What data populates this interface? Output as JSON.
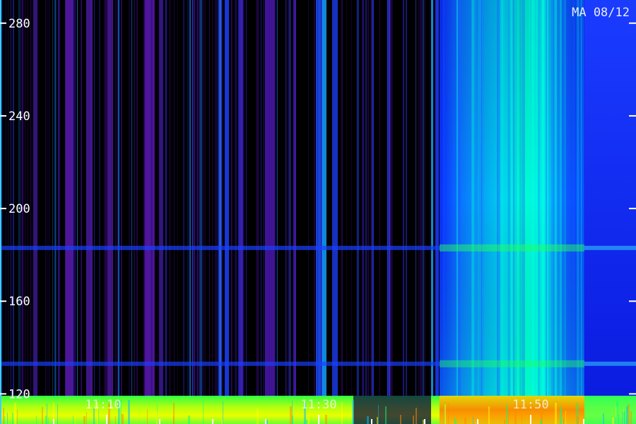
{
  "chart_data": {
    "type": "heatmap",
    "title": "",
    "panel_label": "MA 08/12",
    "xlabel": "",
    "ylabel": "",
    "x_tick_labels": [
      "11:10",
      "11:30",
      "11:50"
    ],
    "y_ticks": [
      120,
      160,
      200,
      240,
      280
    ],
    "ylim": [
      107,
      290
    ],
    "colormap": [
      "#000000",
      "#5a1aa8",
      "#1a2aff",
      "#00ffff",
      "#00ff00",
      "#ffff00",
      "#ff0000"
    ],
    "activity_regions": [
      {
        "name": "quiet",
        "level": 0.15
      },
      {
        "name": "burst",
        "level": 0.65
      },
      {
        "name": "decay",
        "level": 0.35
      }
    ],
    "lanes": [
      {
        "name": "constant-line",
        "value": 183,
        "level": 0.5
      },
      {
        "name": "constant-line",
        "value": 133,
        "level": 0.4
      },
      {
        "name": "low-band",
        "value": 110,
        "level": 0.85
      }
    ]
  }
}
